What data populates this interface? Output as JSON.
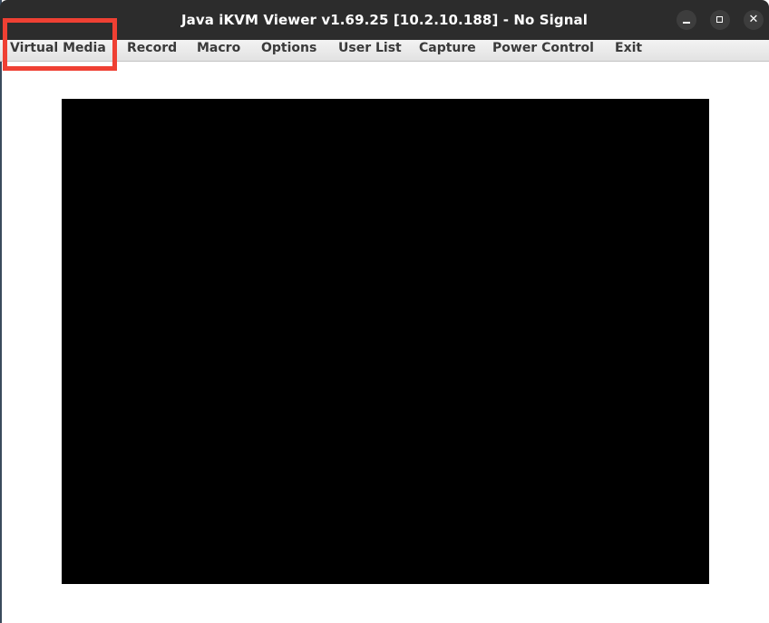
{
  "window": {
    "title": "Java iKVM Viewer v1.69.25 [10.2.10.188]  - No Signal",
    "controls": {
      "minimize_icon": "minimize-icon",
      "maximize_icon": "maximize-icon",
      "close_icon": "close-icon",
      "close_glyph": "✕"
    }
  },
  "menubar": {
    "items": [
      {
        "label": "Virtual Media"
      },
      {
        "label": "Record"
      },
      {
        "label": "Macro"
      },
      {
        "label": "Options"
      },
      {
        "label": "User List"
      },
      {
        "label": "Capture"
      },
      {
        "label": "Power Control"
      },
      {
        "label": "Exit"
      }
    ]
  },
  "colors": {
    "titlebar": "#2c2c2c",
    "menubar": "#e6e6e6",
    "highlight": "#ef4033",
    "video_background": "#000000"
  }
}
